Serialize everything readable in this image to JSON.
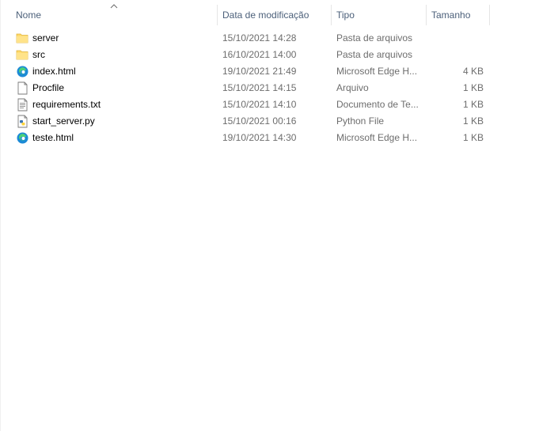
{
  "columns": {
    "name": "Nome",
    "date": "Data de modificação",
    "type": "Tipo",
    "size": "Tamanho"
  },
  "files": [
    {
      "name": "server",
      "date": "15/10/2021 14:28",
      "type": "Pasta de arquivos",
      "size": "",
      "icon": "folder-icon"
    },
    {
      "name": "src",
      "date": "16/10/2021 14:00",
      "type": "Pasta de arquivos",
      "size": "",
      "icon": "folder-icon"
    },
    {
      "name": "index.html",
      "date": "19/10/2021 21:49",
      "type": "Microsoft Edge H...",
      "size": "4 KB",
      "icon": "edge-icon"
    },
    {
      "name": "Procfile",
      "date": "15/10/2021 14:15",
      "type": "Arquivo",
      "size": "1 KB",
      "icon": "file-icon"
    },
    {
      "name": "requirements.txt",
      "date": "15/10/2021 14:10",
      "type": "Documento de Te...",
      "size": "1 KB",
      "icon": "text-file-icon"
    },
    {
      "name": "start_server.py",
      "date": "15/10/2021 00:16",
      "type": "Python File",
      "size": "1 KB",
      "icon": "python-file-icon"
    },
    {
      "name": "teste.html",
      "date": "19/10/2021 14:30",
      "type": "Microsoft Edge H...",
      "size": "1 KB",
      "icon": "edge-icon"
    }
  ],
  "colors": {
    "header_text": "#4c607a",
    "secondary_text": "#6d6d6d",
    "folder_yellow": "#ffd866"
  }
}
